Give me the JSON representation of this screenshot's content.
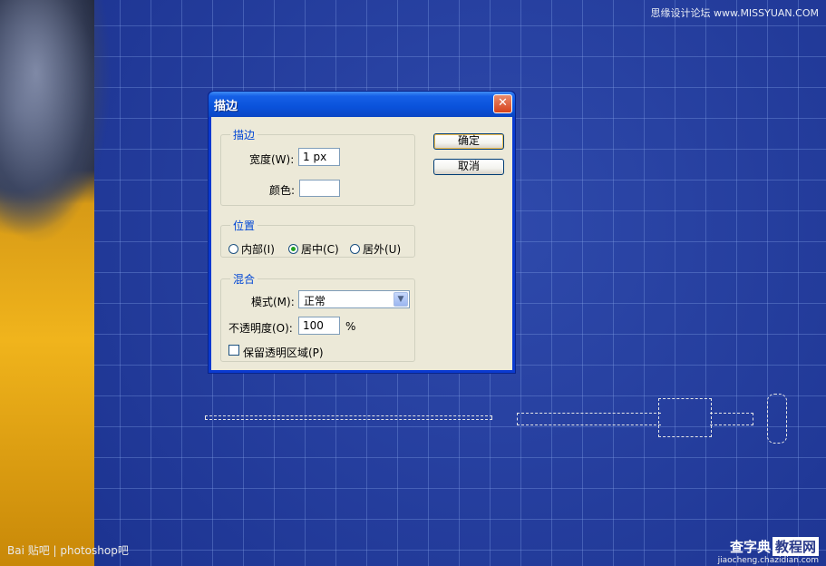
{
  "watermarks": {
    "top_right": "思缘设计论坛 www.MISSYUAN.COM",
    "bottom_left": "Bai 贴吧 | photoshop吧",
    "site_name": "查字典",
    "site_box": "教程网",
    "site_url": "jiaocheng.chazidian.com"
  },
  "dialog": {
    "title": "描边",
    "close_label": "✕",
    "ok_label": "确定",
    "cancel_label": "取消",
    "stroke_group": {
      "legend": "描边",
      "width_label": "宽度(W):",
      "width_value": "1 px",
      "color_label": "颜色:",
      "color_value": "#ffffff"
    },
    "position_group": {
      "legend": "位置",
      "options": [
        "内部(I)",
        "居中(C)",
        "居外(U)"
      ],
      "selected": "居中(C)"
    },
    "blend_group": {
      "legend": "混合",
      "mode_label": "模式(M):",
      "mode_value": "正常",
      "opacity_label": "不透明度(O):",
      "opacity_value": "100",
      "opacity_unit": "%",
      "preserve_label": "保留透明区域(P)",
      "preserve_checked": false
    }
  },
  "colors": {
    "canvas_blue": "#1b3290",
    "dialog_frame": "#0b3ad0",
    "group_legend": "#0046d5",
    "close_red": "#d7421b"
  }
}
